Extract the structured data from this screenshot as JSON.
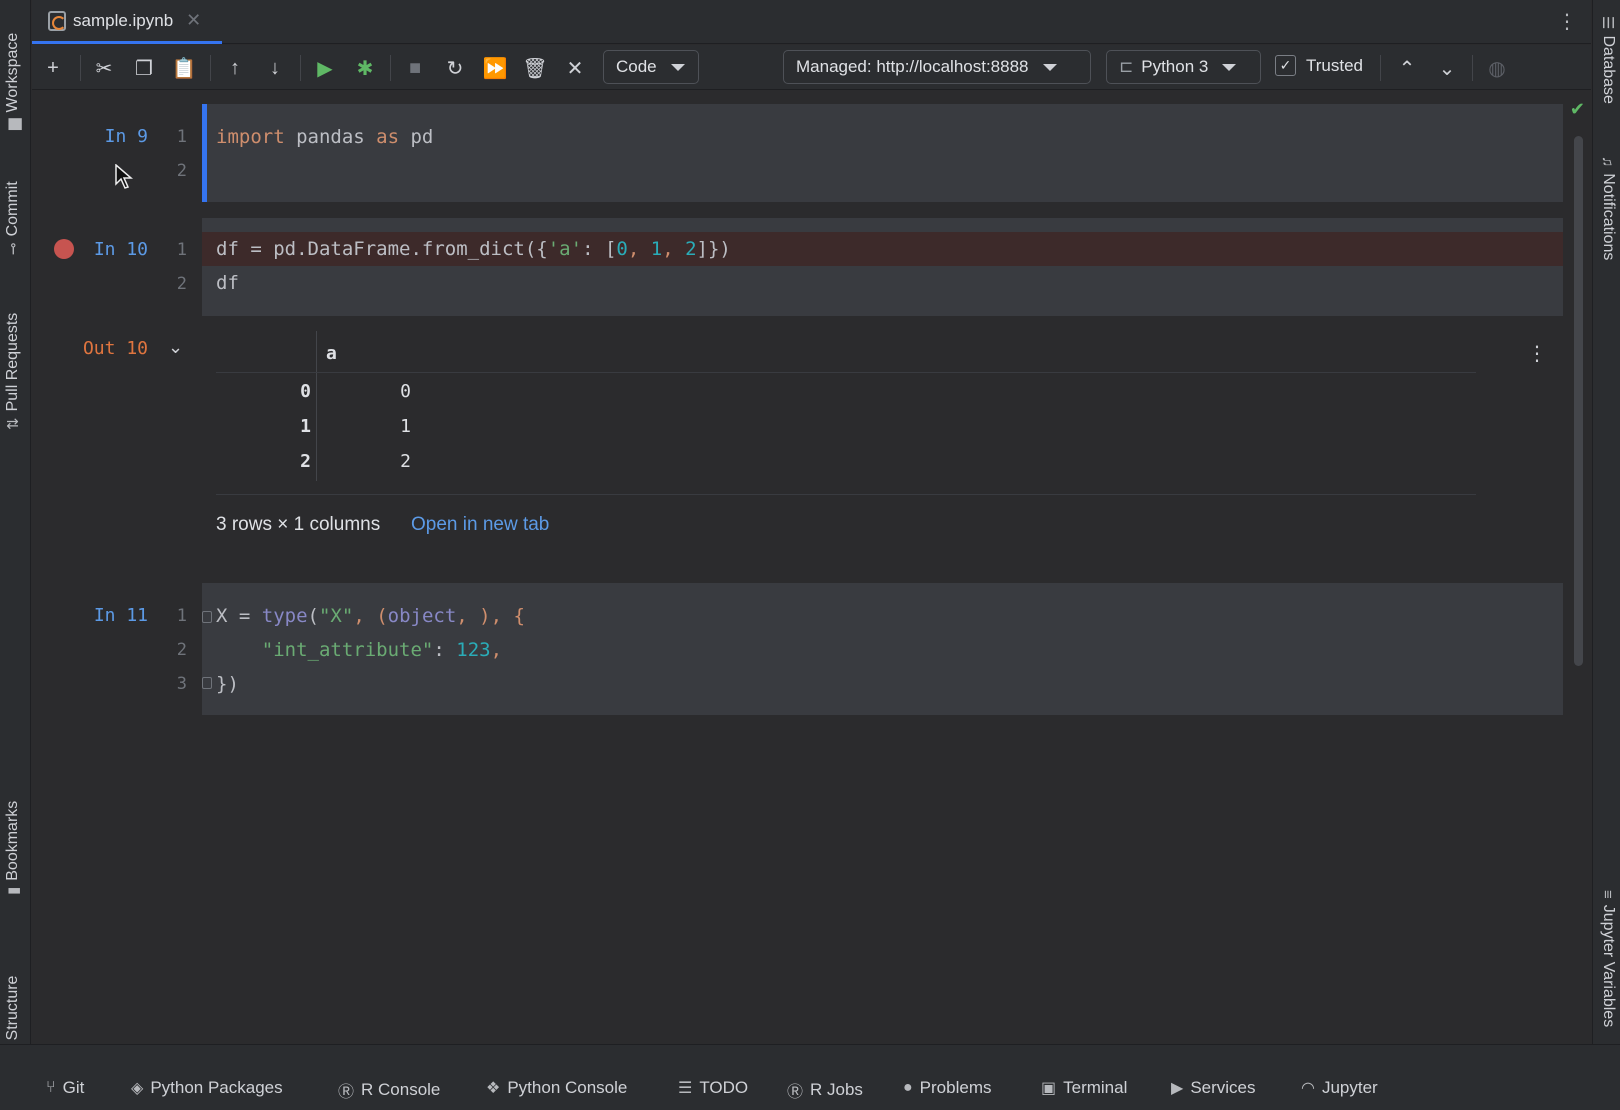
{
  "tab": {
    "filename": "sample.ipynb"
  },
  "toolbar": {
    "cell_type": "Code",
    "server": "Managed: http://localhost:8888",
    "kernel": "Python 3",
    "trusted_label": "Trusted",
    "trusted_checked": true
  },
  "left_tools": [
    "Workspace",
    "Commit",
    "Pull Requests",
    "Bookmarks",
    "Structure"
  ],
  "right_tools": [
    "Database",
    "Notifications",
    "Jupyter Variables"
  ],
  "cells": [
    {
      "label": "In 9",
      "lines": [
        "1",
        "2"
      ]
    },
    {
      "label": "In 10",
      "lines": [
        "1",
        "2"
      ],
      "breakpoint": true
    },
    {
      "label": "In 11",
      "lines": [
        "1",
        "2",
        "3"
      ]
    }
  ],
  "output": {
    "label": "Out 10",
    "column_header": "a",
    "index": [
      "0",
      "1",
      "2"
    ],
    "values": [
      "0",
      "1",
      "2"
    ],
    "summary": "3 rows × 1 columns",
    "open_link": "Open in new tab"
  },
  "code": {
    "c1_l1": {
      "kw1": "import",
      "mid": " pandas ",
      "kw2": "as",
      "end": " pd"
    },
    "c2_l1": {
      "a": "df = pd.DataFrame.from_dict({",
      "s": "'a'",
      "b": ": [",
      "n0": "0",
      "c1": ", ",
      "n1": "1",
      "c2": ", ",
      "n2": "2",
      "e": "]})"
    },
    "c2_l2": "df",
    "c3_l1": {
      "a": "X = ",
      "b": "type",
      "c": "(",
      "s": "\"X\"",
      "d": ", (",
      "o": "object",
      "e": ", ), {"
    },
    "c3_l2": {
      "indent": "    ",
      "s": "\"int_attribute\"",
      "colon": ": ",
      "n": "123",
      "comma": ","
    },
    "c3_l3": "})"
  },
  "bottom_tools": [
    "Git",
    "Python Packages",
    "R Console",
    "Python Console",
    "TODO",
    "R Jobs",
    "Problems",
    "Terminal",
    "Services",
    "Jupyter"
  ],
  "colors": {
    "accent": "#3574f0",
    "keyword": "#cf8e6d",
    "string": "#6aab73",
    "number": "#2aacb8",
    "breakpoint": "#c75450"
  }
}
